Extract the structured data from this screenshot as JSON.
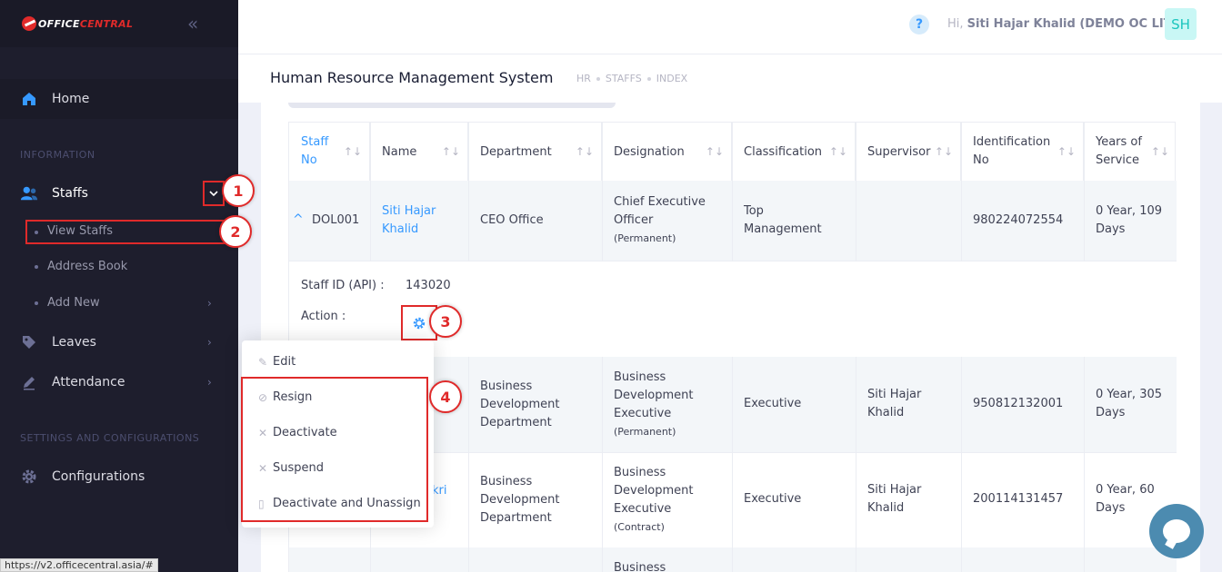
{
  "brand": {
    "logo_a": "OFFICE",
    "logo_b": "CENTRAL"
  },
  "sidebar": {
    "home": "Home",
    "section_information": "INFORMATION",
    "staffs": "Staffs",
    "staffs_sub": [
      "View Staffs",
      "Address Book",
      "Add New"
    ],
    "leaves": "Leaves",
    "attendance": "Attendance",
    "section_settings": "SETTINGS AND CONFIGURATIONS",
    "configurations": "Configurations"
  },
  "header": {
    "greeting_prefix": "Hi,",
    "user": "Siti Hajar Khalid (DEMO OC LITE)",
    "avatar": "SH",
    "help": "?"
  },
  "subheader": {
    "title": "Human Resource Management System",
    "breadcrumbs": [
      "HR",
      "STAFFS",
      "INDEX"
    ]
  },
  "table": {
    "columns": [
      "Staff No",
      "Name",
      "Department",
      "Designation",
      "Classification",
      "Supervisor",
      "Identification No",
      "Years of Service"
    ],
    "col_wrapped": {
      "staff_no": [
        "Staff",
        "No"
      ],
      "ident": [
        "Identification",
        "No"
      ],
      "years": [
        "Years of",
        "Service"
      ]
    },
    "rows": [
      {
        "staff_no": "DOL001",
        "name": [
          "Siti Hajar",
          "Khalid"
        ],
        "department": [
          "CEO Office"
        ],
        "designation": [
          "Chief Executive",
          "Officer"
        ],
        "desig_type": "(Permanent)",
        "classification": [
          "Top",
          "Management"
        ],
        "supervisor": [],
        "ident": "980224072554",
        "years": [
          "0 Year, 109",
          "Days"
        ]
      },
      {
        "staff_no": "",
        "name": [],
        "department": [
          "Business",
          "Development",
          "Department"
        ],
        "designation": [
          "Business",
          "Development",
          "Executive"
        ],
        "desig_type": "(Permanent)",
        "classification": [
          "Executive"
        ],
        "supervisor": [
          "Siti Hajar",
          "Khalid"
        ],
        "ident": "950812132001",
        "years": [
          "0 Year, 305",
          "Days"
        ]
      },
      {
        "staff_no": "",
        "name": [
          "kri"
        ],
        "department": [
          "Business",
          "Development",
          "Department"
        ],
        "designation": [
          "Business",
          "Development",
          "Executive"
        ],
        "desig_type": "(Contract)",
        "classification": [
          "Executive"
        ],
        "supervisor": [
          "Siti Hajar",
          "Khalid"
        ],
        "ident": "200114131457",
        "years": [
          "0 Year, 60",
          "Days"
        ]
      },
      {
        "designation": [
          "Business"
        ]
      }
    ],
    "detail": {
      "staff_id_label": "Staff ID (API) :",
      "staff_id_value": "143020",
      "action_label": "Action :"
    }
  },
  "action_menu": [
    "Edit",
    "Resign",
    "Deactivate",
    "Suspend",
    "Deactivate and Unassign"
  ],
  "annotations": [
    "1",
    "2",
    "3",
    "4"
  ],
  "status_url": "https://v2.officecentral.asia/#",
  "colors": {
    "accent": "#3699ff",
    "annotation": "#e02a2a",
    "sidebar": "#1e1e2d"
  }
}
